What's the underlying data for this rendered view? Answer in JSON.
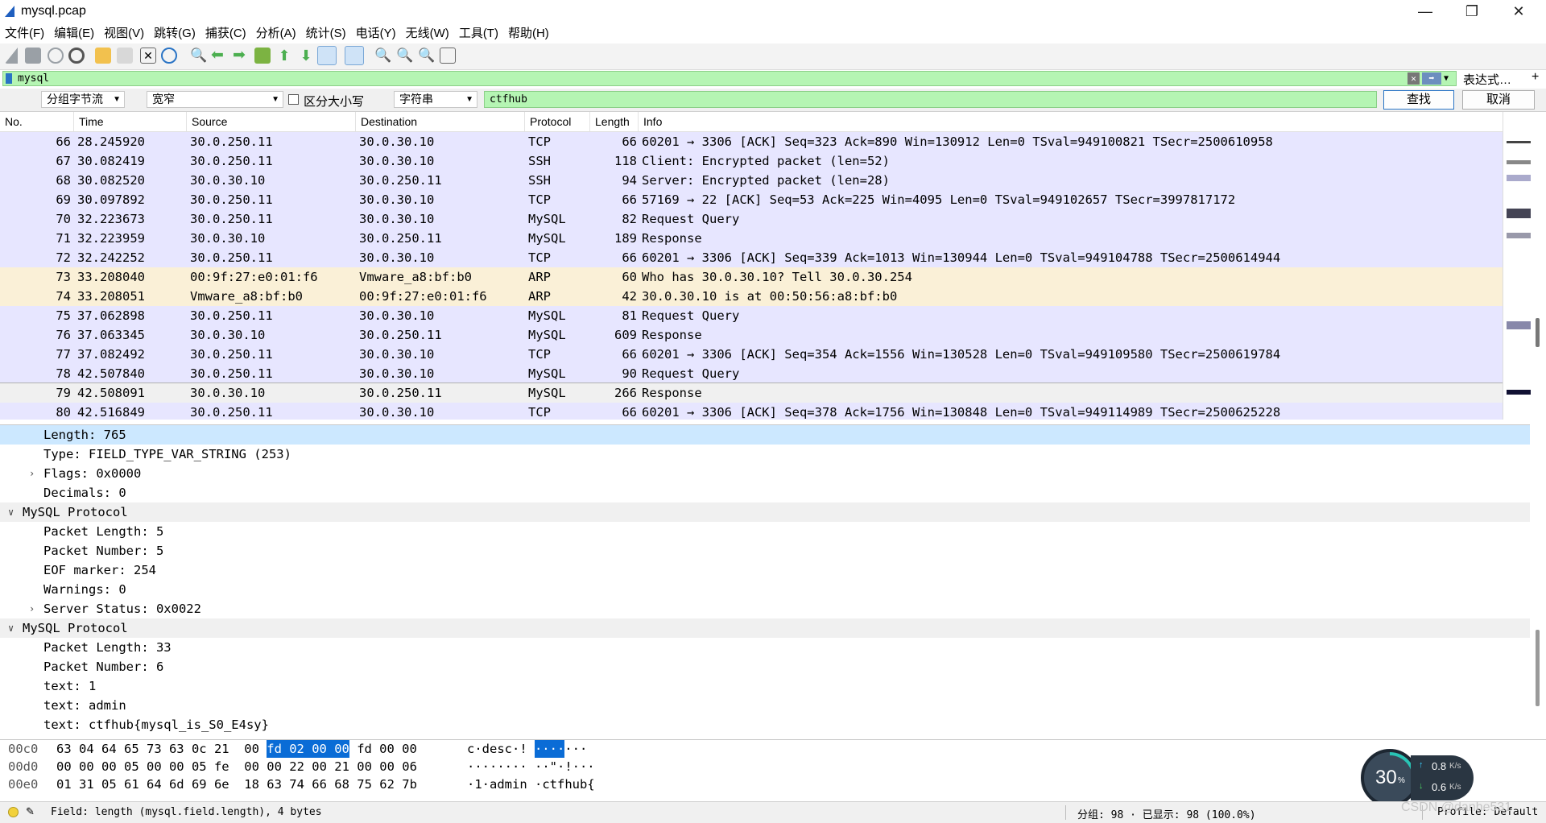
{
  "window": {
    "title": "mysql.pcap"
  },
  "menu": [
    "文件(F)",
    "编辑(E)",
    "视图(V)",
    "跳转(G)",
    "捕获(C)",
    "分析(A)",
    "统计(S)",
    "电话(Y)",
    "无线(W)",
    "工具(T)",
    "帮助(H)"
  ],
  "filter": {
    "value": "mysql",
    "expression_label": "表达式…",
    "plus_label": "+"
  },
  "search": {
    "scope": "分组字节流",
    "width_mode": "宽窄",
    "case_label": "区分大小写",
    "type": "字符串",
    "value": "ctfhub",
    "find_label": "查找",
    "cancel_label": "取消"
  },
  "packet_list": {
    "columns": [
      "No.",
      "Time",
      "Source",
      "Destination",
      "Protocol",
      "Length",
      "Info"
    ],
    "rows": [
      {
        "no": "66",
        "time": "28.245920",
        "src": "30.0.250.11",
        "dst": "30.0.30.10",
        "proto": "TCP",
        "len": "66",
        "info": "60201 → 3306 [ACK] Seq=323 Ack=890 Win=130912 Len=0 TSval=949100821 TSecr=2500610958",
        "color": "#e7e6ff"
      },
      {
        "no": "67",
        "time": "30.082419",
        "src": "30.0.250.11",
        "dst": "30.0.30.10",
        "proto": "SSH",
        "len": "118",
        "info": "Client: Encrypted packet (len=52)",
        "color": "#e7e6ff"
      },
      {
        "no": "68",
        "time": "30.082520",
        "src": "30.0.30.10",
        "dst": "30.0.250.11",
        "proto": "SSH",
        "len": "94",
        "info": "Server: Encrypted packet (len=28)",
        "color": "#e7e6ff"
      },
      {
        "no": "69",
        "time": "30.097892",
        "src": "30.0.250.11",
        "dst": "30.0.30.10",
        "proto": "TCP",
        "len": "66",
        "info": "57169 → 22 [ACK] Seq=53 Ack=225 Win=4095 Len=0 TSval=949102657 TSecr=3997817172",
        "color": "#e7e6ff"
      },
      {
        "no": "70",
        "time": "32.223673",
        "src": "30.0.250.11",
        "dst": "30.0.30.10",
        "proto": "MySQL",
        "len": "82",
        "info": "Request Query",
        "color": "#e7e6ff"
      },
      {
        "no": "71",
        "time": "32.223959",
        "src": "30.0.30.10",
        "dst": "30.0.250.11",
        "proto": "MySQL",
        "len": "189",
        "info": "Response",
        "color": "#e7e6ff"
      },
      {
        "no": "72",
        "time": "32.242252",
        "src": "30.0.250.11",
        "dst": "30.0.30.10",
        "proto": "TCP",
        "len": "66",
        "info": "60201 → 3306 [ACK] Seq=339 Ack=1013 Win=130944 Len=0 TSval=949104788 TSecr=2500614944",
        "color": "#e7e6ff"
      },
      {
        "no": "73",
        "time": "33.208040",
        "src": "00:9f:27:e0:01:f6",
        "dst": "Vmware_a8:bf:b0",
        "proto": "ARP",
        "len": "60",
        "info": "Who has 30.0.30.10? Tell 30.0.30.254",
        "color": "#faf0d7"
      },
      {
        "no": "74",
        "time": "33.208051",
        "src": "Vmware_a8:bf:b0",
        "dst": "00:9f:27:e0:01:f6",
        "proto": "ARP",
        "len": "42",
        "info": "30.0.30.10 is at 00:50:56:a8:bf:b0",
        "color": "#faf0d7"
      },
      {
        "no": "75",
        "time": "37.062898",
        "src": "30.0.250.11",
        "dst": "30.0.30.10",
        "proto": "MySQL",
        "len": "81",
        "info": "Request Query",
        "color": "#e7e6ff"
      },
      {
        "no": "76",
        "time": "37.063345",
        "src": "30.0.30.10",
        "dst": "30.0.250.11",
        "proto": "MySQL",
        "len": "609",
        "info": "Response",
        "color": "#e7e6ff"
      },
      {
        "no": "77",
        "time": "37.082492",
        "src": "30.0.250.11",
        "dst": "30.0.30.10",
        "proto": "TCP",
        "len": "66",
        "info": "60201 → 3306 [ACK] Seq=354 Ack=1556 Win=130528 Len=0 TSval=949109580 TSecr=2500619784",
        "color": "#e7e6ff"
      },
      {
        "no": "78",
        "time": "42.507840",
        "src": "30.0.250.11",
        "dst": "30.0.30.10",
        "proto": "MySQL",
        "len": "90",
        "info": "Request Query",
        "color": "#e7e6ff"
      },
      {
        "no": "79",
        "time": "42.508091",
        "src": "30.0.30.10",
        "dst": "30.0.250.11",
        "proto": "MySQL",
        "len": "266",
        "info": "Response",
        "color": "#f0f0f0",
        "selected": true
      },
      {
        "no": "80",
        "time": "42.516849",
        "src": "30.0.250.11",
        "dst": "30.0.30.10",
        "proto": "TCP",
        "len": "66",
        "info": "60201 → 3306 [ACK] Seq=378 Ack=1756 Win=130848 Len=0 TSval=949114989 TSecr=2500625228",
        "color": "#e7e6ff"
      }
    ]
  },
  "details": [
    {
      "indent": 1,
      "caret": "",
      "text": "Length: 765",
      "highlight": true
    },
    {
      "indent": 1,
      "caret": "",
      "text": "Type: FIELD_TYPE_VAR_STRING (253)"
    },
    {
      "indent": 1,
      "caret": ">",
      "text": "Flags: 0x0000"
    },
    {
      "indent": 1,
      "caret": "",
      "text": "Decimals: 0"
    },
    {
      "indent": 0,
      "caret": "v",
      "text": "MySQL Protocol",
      "section": true
    },
    {
      "indent": 1,
      "caret": "",
      "text": "Packet Length: 5"
    },
    {
      "indent": 1,
      "caret": "",
      "text": "Packet Number: 5"
    },
    {
      "indent": 1,
      "caret": "",
      "text": "EOF marker: 254"
    },
    {
      "indent": 1,
      "caret": "",
      "text": "Warnings: 0"
    },
    {
      "indent": 1,
      "caret": ">",
      "text": "Server Status: 0x0022"
    },
    {
      "indent": 0,
      "caret": "v",
      "text": "MySQL Protocol",
      "section": true
    },
    {
      "indent": 1,
      "caret": "",
      "text": "Packet Length: 33"
    },
    {
      "indent": 1,
      "caret": "",
      "text": "Packet Number: 6"
    },
    {
      "indent": 1,
      "caret": "",
      "text": "text: 1"
    },
    {
      "indent": 1,
      "caret": "",
      "text": "text: admin"
    },
    {
      "indent": 1,
      "caret": "",
      "text": "text: ctfhub{mysql_is_S0_E4sy}"
    }
  ],
  "hex": [
    {
      "offset": "00c0",
      "bytes_a": "63 04 64 65 73 63 0c 21  00 ",
      "bytes_hl": "fd 02 00 00",
      "bytes_b": " fd 00 00",
      "ascii_a": "c·desc·! ",
      "ascii_hl": "····",
      "ascii_b": "···"
    },
    {
      "offset": "00d0",
      "bytes_a": "00 00 00 05 00 00 05 fe  00 00 22 00 21 00 00 06",
      "bytes_hl": "",
      "bytes_b": "",
      "ascii_a": "········ ··\"·!···",
      "ascii_hl": "",
      "ascii_b": ""
    },
    {
      "offset": "00e0",
      "bytes_a": "01 31 05 61 64 6d 69 6e  18 63 74 66 68 75 62 7b",
      "bytes_hl": "",
      "bytes_b": "",
      "ascii_a": "·1·admin ·ctfhub{",
      "ascii_hl": "",
      "ascii_b": ""
    }
  ],
  "status": {
    "field": "Field: length (mysql.field.length), 4 bytes",
    "packets": "分组: 98 · 已显示: 98 (100.0%)",
    "profile": "Profile: Default"
  },
  "speed_widget": {
    "percent": "30",
    "percent_unit": "%",
    "up": "0.8",
    "down": "0.6",
    "unit": "K/s",
    "watermark": "CSDN @danhe531"
  }
}
